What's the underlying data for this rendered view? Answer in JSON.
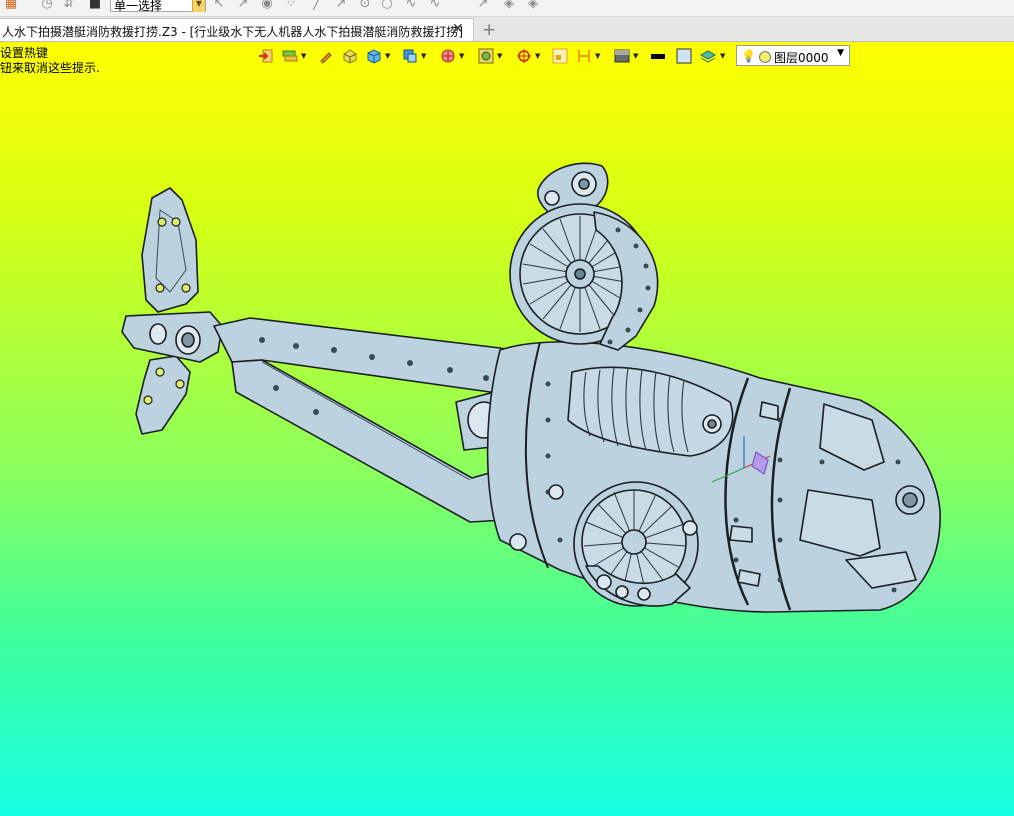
{
  "top_toolbar": {
    "selection_mode": "单一选择",
    "icons": [
      "app-icon",
      "filter-icon",
      "cursor-icon",
      "stop-icon",
      "pick-icon",
      "pick2-icon",
      "play-icon",
      "scatter-icon",
      "line-icon",
      "arrow-line-icon",
      "point-circle-icon",
      "circle-icon",
      "curve-icon",
      "spline-icon",
      "arc-icon",
      "arrow-icon",
      "surface-icon",
      "surface2-icon"
    ]
  },
  "tab": {
    "title": "人水下拍摄潜艇消防救援打捞.Z3 - [行业级水下无人机器人水下拍摄潜艇消防救援打捞]",
    "close": "✕",
    "new": "+"
  },
  "hint": {
    "line1": "设置热键",
    "line2": "钮来取消这些提示."
  },
  "view_toolbar": {
    "layer": "图层0000",
    "colors": {
      "accent_orange": "#e8a317",
      "layer_dot": "#f1f169",
      "line_black": "#000000"
    }
  },
  "viewport": {
    "background_top": "#ffff00",
    "background_bottom": "#16ffe1",
    "model_color": "#b9cfdc"
  }
}
